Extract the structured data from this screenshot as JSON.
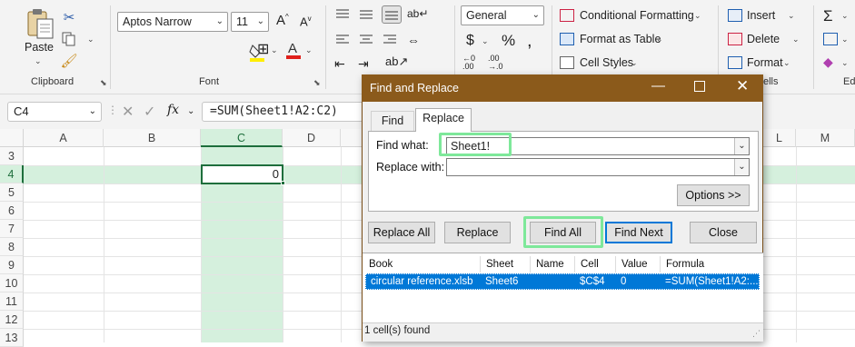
{
  "ribbon": {
    "clipboard": {
      "paste_label": "Paste",
      "group_label": "Clipboard"
    },
    "font": {
      "font_name": "Aptos Narrow",
      "font_size": "11",
      "group_label": "Font"
    },
    "number": {
      "format": "General"
    },
    "styles": {
      "conditional_formatting": "Conditional Formatting",
      "format_as_table": "Format as Table",
      "cell_styles": "Cell Styles"
    },
    "cells": {
      "insert": "Insert",
      "delete": "Delete",
      "format": "Format",
      "group_label_partial": "ells"
    },
    "editing": {
      "group_label_partial": "Ed"
    },
    "colors": {
      "highlight": "#ffee00",
      "font_color": "#e0201b"
    }
  },
  "formula_bar": {
    "name_box": "C4",
    "fx": "fx",
    "formula": "=SUM(Sheet1!A2:C2)"
  },
  "grid": {
    "columns": [
      "A",
      "B",
      "C",
      "D",
      "L",
      "M"
    ],
    "rows": [
      "3",
      "4",
      "5",
      "6",
      "7",
      "8",
      "9",
      "10",
      "11",
      "12",
      "13"
    ],
    "active_cell_value": "0",
    "colors": {
      "selection": "#d5f0dd",
      "active_border": "#1e6e3c"
    }
  },
  "dialog": {
    "title": "Find and Replace",
    "tabs": [
      "Find",
      "Replace"
    ],
    "find_what_label": "Find what:",
    "find_what_value": "Sheet1!",
    "replace_with_label": "Replace with:",
    "replace_with_value": "",
    "options_button": "Options >>",
    "buttons": {
      "replace_all": "Replace All",
      "replace": "Replace",
      "find_all": "Find All",
      "find_next": "Find Next",
      "close": "Close"
    },
    "results": {
      "headers": [
        "Book",
        "Sheet",
        "Name",
        "Cell",
        "Value",
        "Formula"
      ],
      "rows": [
        {
          "book": "circular reference.xlsb",
          "sheet": "Sheet6",
          "name": "",
          "cell": "$C$4",
          "value": "0",
          "formula": "=SUM(Sheet1!A2:..."
        }
      ]
    },
    "status": "1 cell(s) found",
    "colors": {
      "title_bar": "#8b5a1b",
      "selected_row": "#0078d7",
      "highlight": "#7ee89a"
    }
  }
}
